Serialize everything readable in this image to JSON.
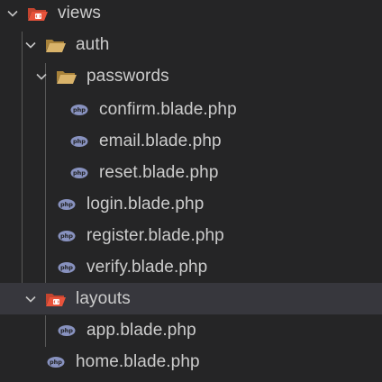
{
  "explorer": {
    "views": {
      "label": "views",
      "icon": "folder-views-open-icon",
      "expanded": true
    },
    "auth": {
      "label": "auth",
      "icon": "folder-open-icon",
      "expanded": true
    },
    "passwords": {
      "label": "passwords",
      "icon": "folder-open-icon",
      "expanded": true
    },
    "confirm": {
      "label": "confirm.blade.php",
      "icon": "php-file-icon"
    },
    "email": {
      "label": "email.blade.php",
      "icon": "php-file-icon"
    },
    "reset": {
      "label": "reset.blade.php",
      "icon": "php-file-icon"
    },
    "login": {
      "label": "login.blade.php",
      "icon": "php-file-icon"
    },
    "register": {
      "label": "register.blade.php",
      "icon": "php-file-icon"
    },
    "verify": {
      "label": "verify.blade.php",
      "icon": "php-file-icon"
    },
    "layouts": {
      "label": "layouts",
      "icon": "folder-views-open-icon",
      "expanded": true,
      "selected": true
    },
    "app": {
      "label": "app.blade.php",
      "icon": "php-file-icon"
    },
    "home": {
      "label": "home.blade.php",
      "icon": "php-file-icon"
    }
  },
  "colors": {
    "background": "#252526",
    "selected_row": "#37373d",
    "text": "#cccccc",
    "folder": "#c9a04a",
    "views_folder": "#e8533b",
    "php": "#8892bf"
  }
}
